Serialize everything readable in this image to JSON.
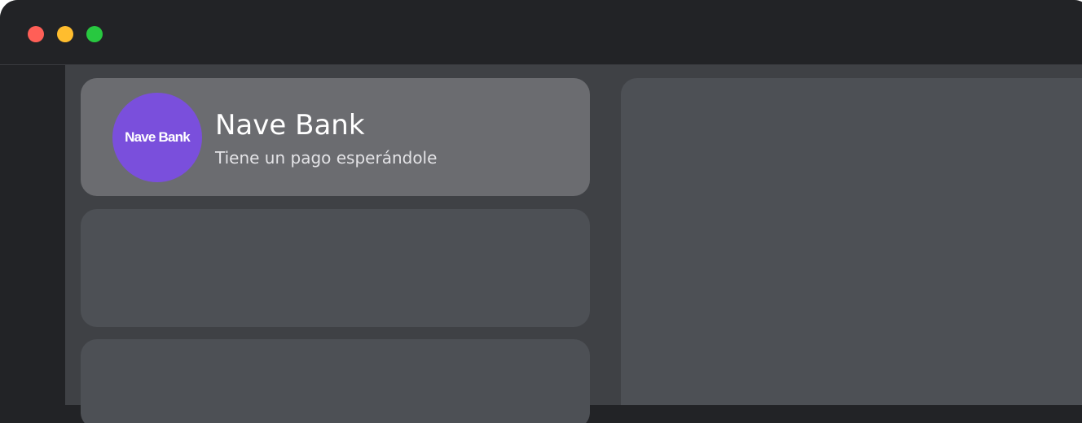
{
  "window": {
    "controls": [
      "close",
      "minimize",
      "maximize"
    ]
  },
  "notification": {
    "avatar_text": "Nave Bank",
    "avatar_color": "#7a4fdc",
    "title": "Nave Bank",
    "subtitle": "Tiene un pago esperándole"
  }
}
